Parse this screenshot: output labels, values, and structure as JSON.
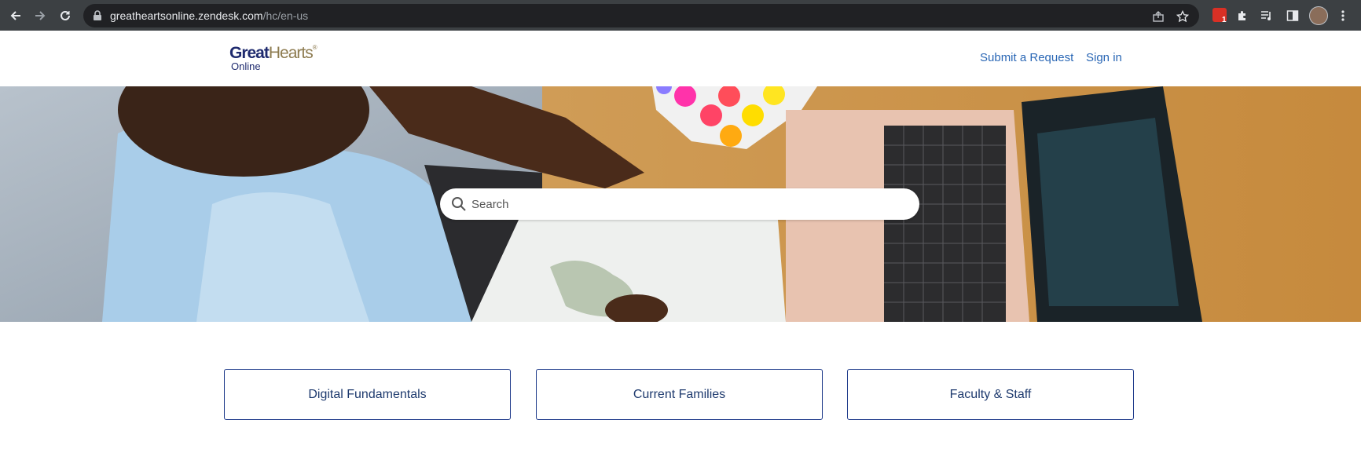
{
  "browser": {
    "url_host": "greatheartsonline.zendesk.com",
    "url_path": "/hc/en-us",
    "extension_badge_count": "1"
  },
  "header": {
    "logo_great": "Great",
    "logo_hearts": "Hearts",
    "logo_online": "Online",
    "links": {
      "submit_request": "Submit a Request",
      "sign_in": "Sign in"
    }
  },
  "hero": {
    "search_placeholder": "Search"
  },
  "categories": [
    {
      "label": "Digital Fundamentals"
    },
    {
      "label": "Current Families"
    },
    {
      "label": "Faculty & Staff"
    }
  ],
  "colors": {
    "chrome_bg": "#3c4043",
    "omnibox_bg": "#202124",
    "link_blue": "#2a67b5",
    "brand_navy": "#1e2a6e",
    "brand_gold": "#8c7a4e",
    "card_border": "#1e3a8a"
  },
  "icons": [
    "back-arrow-icon",
    "forward-arrow-icon",
    "reload-icon",
    "lock-icon",
    "share-icon",
    "star-icon",
    "extension-icon",
    "puzzle-icon",
    "media-icon",
    "sidepanel-icon",
    "menu-dots-icon",
    "search-icon"
  ]
}
